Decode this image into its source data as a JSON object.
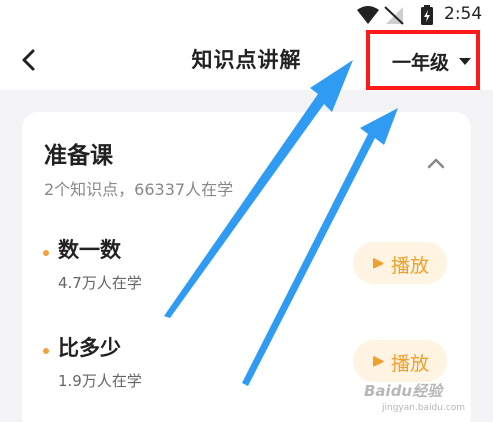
{
  "status_bar": {
    "time": "2:54",
    "icons": [
      "wifi-icon",
      "no-signal-icon",
      "battery-charging-icon"
    ]
  },
  "header": {
    "title": "知识点讲解",
    "back_icon": "chevron-left-icon",
    "grade_selector": {
      "selected": "一年级",
      "icon": "caret-down-icon",
      "highlight_color": "#ff1a1a"
    }
  },
  "course": {
    "title": "准备课",
    "subtitle": "2个知识点，66337人在学",
    "collapse_icon": "chevron-up-icon",
    "items": [
      {
        "title": "数一数",
        "learners": "4.7万人在学",
        "play_label": "播放"
      },
      {
        "title": "比多少",
        "learners": "1.9万人在学",
        "play_label": "播放"
      }
    ]
  },
  "colors": {
    "accent": "#f0a02c",
    "play_bg": "#fff3e2",
    "annotation_arrow": "#2f9bf2",
    "page_bg": "#f3f3f5"
  },
  "watermark": {
    "logo": "Baidu经验",
    "url": "jingyan.baidu.com"
  }
}
